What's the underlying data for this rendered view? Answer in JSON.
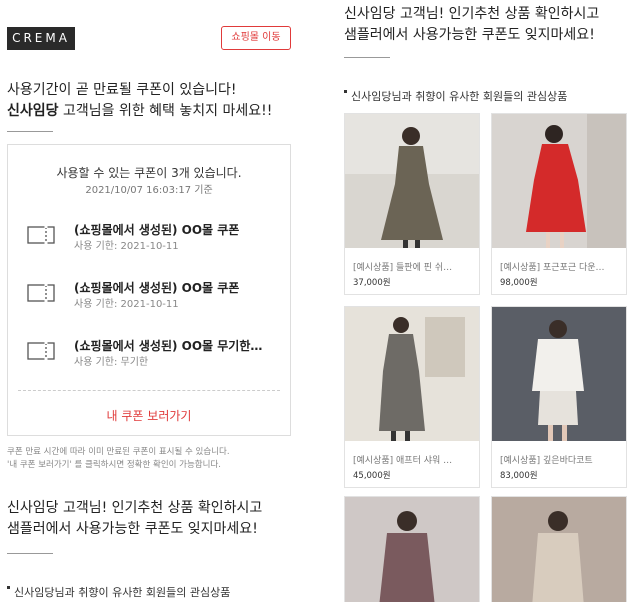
{
  "header": {
    "logo": "CREMA",
    "shop_button": "쇼핑몰 이동"
  },
  "intro": {
    "line1": "사용기간이 곧 만료될 쿠폰이 있습니다!",
    "line2_bold": "신사임당",
    "line2_rest": " 고객님을 위한 혜택 놓치지 마세요!!"
  },
  "coupon_box": {
    "title": "사용할 수 있는 쿠폰이 3개 있습니다.",
    "date": "2021/10/07 16:03:17 기준",
    "coupons": [
      {
        "name": "(쇼핑몰에서 생성된) OO몰 쿠폰",
        "expiry": "사용 기한: 2021-10-11",
        "icon": "coupon-icon"
      },
      {
        "name": "(쇼핑몰에서 생성된) OO몰 쿠폰",
        "expiry": "사용 기한: 2021-10-11",
        "icon": "coupon-icon"
      },
      {
        "name": "(쇼핑몰에서 생성된) OO몰 무기한…",
        "expiry": "사용 기한: 무기한",
        "icon": "coupon-icon"
      }
    ],
    "view_link": "내 쿠폰 보러가기"
  },
  "notice": {
    "line1": "쿠폰 만료 시간에 따라 이미 만료된 쿠폰이 표시될 수 있습니다.",
    "line2": "'내 쿠폰 보러가기' 를 클릭하시면 정확한 확인이 가능합니다."
  },
  "recommend": {
    "title_line1": "신사임당 고객님! 인기추천 상품 확인하시고",
    "title_line2": "샘플러에서 사용가능한 쿠폰도 잊지마세요!",
    "similar_label": "신사임당님과 취향이 유사한 회원들의 관심상품"
  },
  "products": [
    {
      "name": "[예시상품] 들판에 핀 쉬…",
      "price": "37,000원",
      "dress_color": "#6b6455",
      "bg": "#d9d6d0"
    },
    {
      "name": "[예시상품] 포근포근 다운…",
      "price": "98,000원",
      "dress_color": "#d42a2a",
      "bg": "#d8d4d0"
    },
    {
      "name": "[예시상품] 애프터 샤워 …",
      "price": "45,000원",
      "dress_color": "#6e6b66",
      "bg": "#e6e2da"
    },
    {
      "name": "[예시상품] 깊은바다코트",
      "price": "83,000원",
      "dress_color": "#f2f0ec",
      "bg": "#5a5e66"
    },
    {
      "name": "",
      "price": "",
      "dress_color": "#7a5a5e",
      "bg": "#cfc8c6"
    },
    {
      "name": "",
      "price": "",
      "dress_color": "#d8ccbe",
      "bg": "#b8aaa0"
    }
  ]
}
